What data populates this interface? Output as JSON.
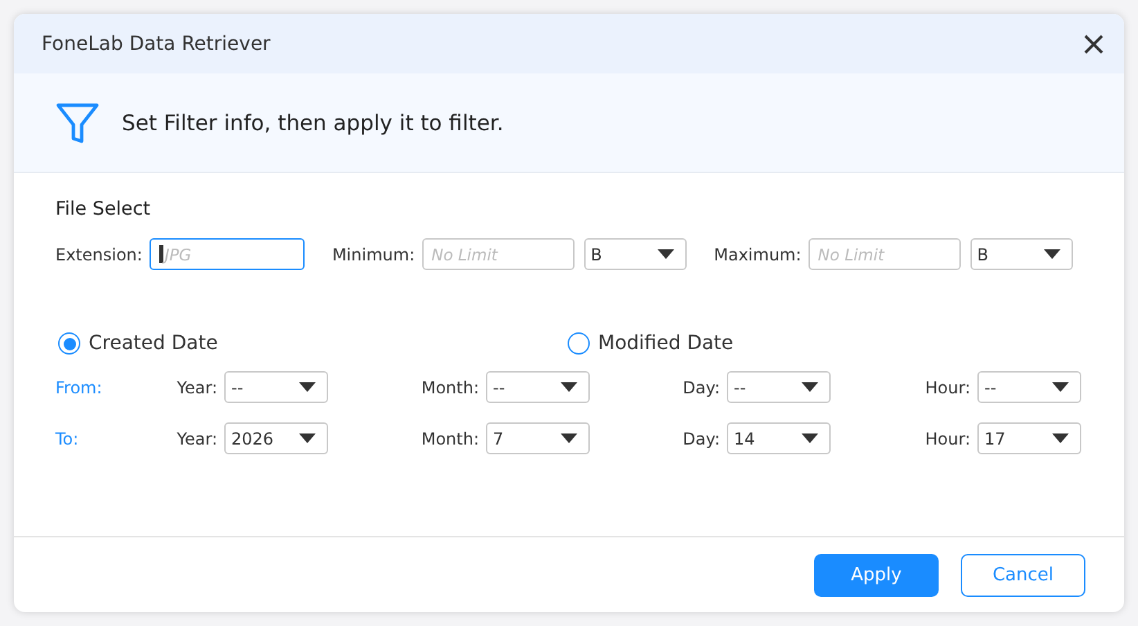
{
  "window": {
    "title": "FoneLab Data Retriever"
  },
  "header": {
    "text": "Set Filter info, then apply it to filter."
  },
  "file_select": {
    "title": "File Select",
    "fields": [
      {
        "label": "Extension:",
        "placeholder": "JPG",
        "focused": true
      },
      {
        "label": "Minimum:",
        "placeholder": "No Limit",
        "focused": false,
        "unit": "B"
      },
      {
        "label": "Maximum:",
        "placeholder": "No Limit",
        "focused": false,
        "unit": "B"
      }
    ]
  },
  "date_filter": {
    "options": [
      {
        "label": "Created Date",
        "selected": true
      },
      {
        "label": "Modified Date",
        "selected": false
      }
    ],
    "rows": [
      {
        "label": "From:",
        "fields": [
          {
            "label": "Year:",
            "value": "--"
          },
          {
            "label": "Month:",
            "value": "--"
          },
          {
            "label": "Day:",
            "value": "--"
          },
          {
            "label": "Hour:",
            "value": "--"
          }
        ]
      },
      {
        "label": "To:",
        "fields": [
          {
            "label": "Year:",
            "value": "2026"
          },
          {
            "label": "Month:",
            "value": "7"
          },
          {
            "label": "Day:",
            "value": "14"
          },
          {
            "label": "Hour:",
            "value": "17"
          }
        ]
      }
    ]
  },
  "buttons": [
    {
      "label": "Apply",
      "kind": "primary"
    },
    {
      "label": "Cancel",
      "kind": "secondary"
    }
  ]
}
